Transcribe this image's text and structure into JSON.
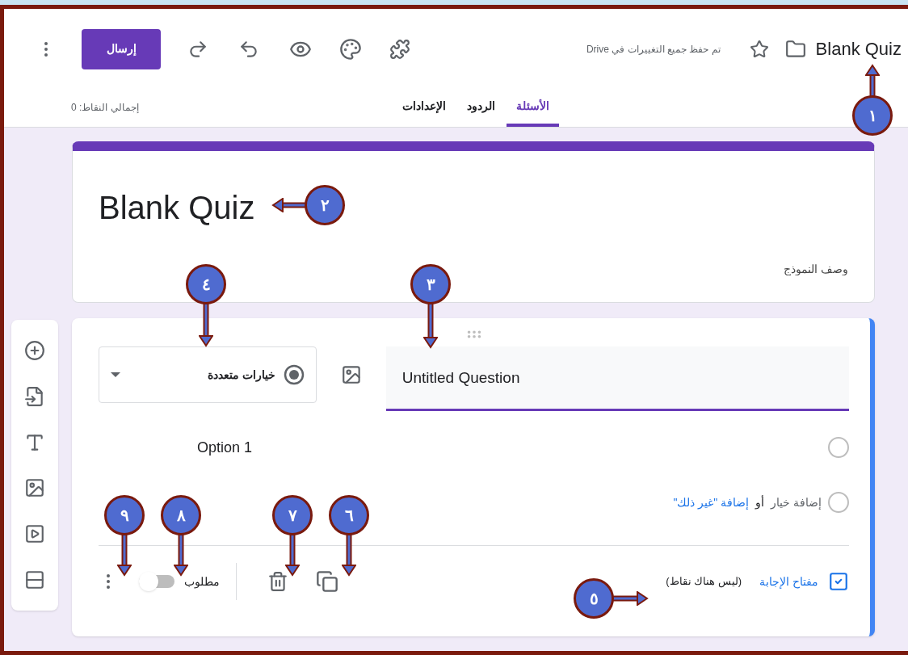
{
  "header": {
    "title": "Blank Quiz",
    "save_status": "تم حفظ جميع التغييرات في Drive",
    "send_button": "إرسال"
  },
  "tabs": [
    {
      "label": "الأسئلة",
      "selected": true
    },
    {
      "label": "الردود",
      "selected": false
    },
    {
      "label": "الإعدادات",
      "selected": false
    }
  ],
  "total_points": "إجمالي النقاط: 0",
  "form": {
    "title": "Blank Quiz",
    "description_placeholder": "وصف النموذج"
  },
  "question": {
    "title": "Untitled Question",
    "type": "خيارات متعددة",
    "options": [
      "Option 1"
    ],
    "add_option": "إضافة خيار",
    "or": "أو",
    "add_other": "إضافة \"غير ذلك\"",
    "answer_key": "مفتاح الإجابة",
    "points": "(ليس هناك نقاط)",
    "required_label": "مطلوب",
    "required": false
  },
  "callouts": [
    {
      "label": "١"
    },
    {
      "label": "٢"
    },
    {
      "label": "٣"
    },
    {
      "label": "٤"
    },
    {
      "label": "٥"
    },
    {
      "label": "٦"
    },
    {
      "label": "٧"
    },
    {
      "label": "٨"
    },
    {
      "label": "٩"
    }
  ]
}
